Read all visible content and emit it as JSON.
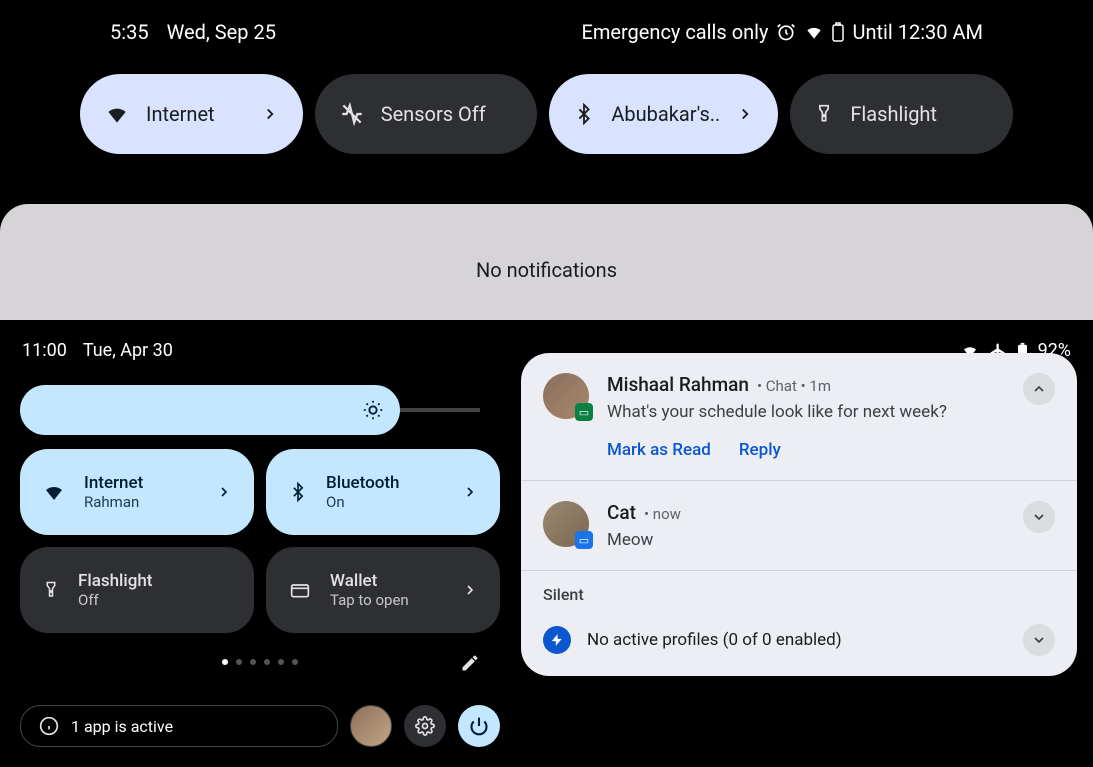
{
  "top": {
    "time": "5:35",
    "date": "Wed, Sep 25",
    "emergency": "Emergency calls only",
    "until": "Until 12:30 AM",
    "tiles": [
      {
        "label": "Internet",
        "active": true,
        "icon": "wifi",
        "chevron": true
      },
      {
        "label": "Sensors Off",
        "active": false,
        "icon": "sensors",
        "chevron": false
      },
      {
        "label": "Abubakar's..",
        "active": true,
        "icon": "bluetooth",
        "chevron": true
      },
      {
        "label": "Flashlight",
        "active": false,
        "icon": "flashlight",
        "chevron": false
      }
    ],
    "no_notifications": "No notifications"
  },
  "bottom": {
    "time": "11:00",
    "date": "Tue, Apr 30",
    "battery": "92%",
    "tiles": [
      {
        "title": "Internet",
        "sub": "Rahman",
        "active": true,
        "icon": "wifi",
        "chevron": true
      },
      {
        "title": "Bluetooth",
        "sub": "On",
        "active": true,
        "icon": "bluetooth",
        "chevron": true
      },
      {
        "title": "Flashlight",
        "sub": "Off",
        "active": false,
        "icon": "flashlight",
        "chevron": false
      },
      {
        "title": "Wallet",
        "sub": "Tap to open",
        "active": false,
        "icon": "wallet",
        "chevron": true
      }
    ],
    "active_apps": "1 app is active"
  },
  "notifications": {
    "items": [
      {
        "name": "Mishaal Rahman",
        "app": "Chat",
        "time": "1m",
        "text": "What's your schedule look like for next week?",
        "actions": [
          "Mark as Read",
          "Reply"
        ],
        "expanded": true
      },
      {
        "name": "Cat",
        "time": "now",
        "text": "Meow",
        "expanded": false
      }
    ],
    "silent_label": "Silent",
    "profiles_text": "No active profiles (0 of 0 enabled)"
  }
}
